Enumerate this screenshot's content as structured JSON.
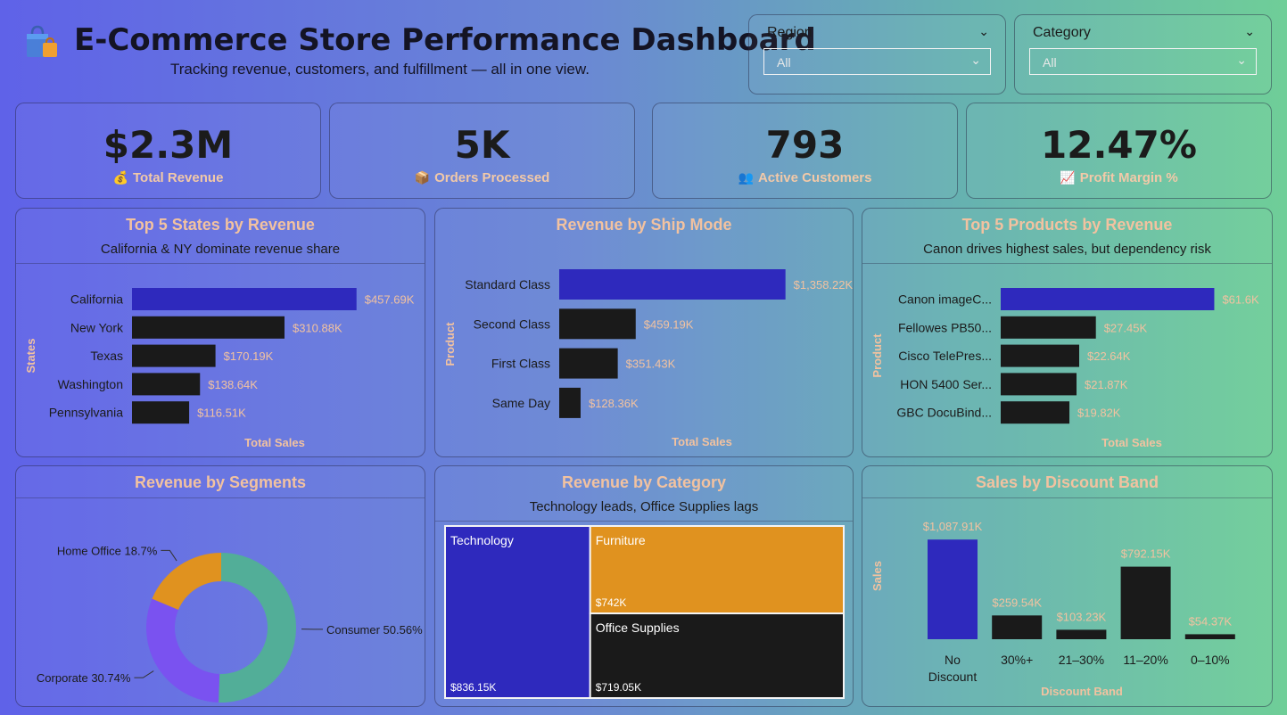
{
  "header": {
    "title": "E-Commerce Store Performance Dashboard",
    "subtitle": "Tracking revenue, customers, and fulfillment — all in one view.",
    "logo_icon": "shopping-bag-icon"
  },
  "slicers": [
    {
      "label": "Region",
      "value": "All"
    },
    {
      "label": "Category",
      "value": "All"
    }
  ],
  "kpis": [
    {
      "value": "$2.3M",
      "label": "Total Revenue",
      "icon": "💰"
    },
    {
      "value": "5K",
      "label": "Orders Processed",
      "icon": "📦"
    },
    {
      "value": "793",
      "label": "Active Customers",
      "icon": "👥"
    },
    {
      "value": "12.47%",
      "label": "Profit Margin %",
      "icon": "📈"
    }
  ],
  "colors": {
    "highlight": "#2e29bd",
    "bar": "#1a1a1a",
    "label": "#f2c2a0",
    "orange": "#e0921f",
    "teal": "#52ae98",
    "purple": "#7a52f0"
  },
  "panels": {
    "states": {
      "title": "Top 5 States by Revenue",
      "subtitle": "California & NY dominate revenue share"
    },
    "shipmode": {
      "title": "Revenue by Ship Mode"
    },
    "products": {
      "title": "Top 5 Products by Revenue",
      "subtitle": "Canon drives highest sales, but dependency risk"
    },
    "segments": {
      "title": "Revenue by Segments"
    },
    "category": {
      "title": "Revenue by Category",
      "subtitle": "Technology leads, Office Supplies lags"
    },
    "discount": {
      "title": "Sales by Discount Band"
    }
  },
  "chart_data": [
    {
      "id": "states",
      "type": "bar",
      "orientation": "horizontal",
      "categories": [
        "California",
        "New York",
        "Texas",
        "Washington",
        "Pennsylvania"
      ],
      "values": [
        457.69,
        310.88,
        170.19,
        138.64,
        116.51
      ],
      "labels": [
        "$457.69K",
        "$310.88K",
        "$170.19K",
        "$138.64K",
        "$116.51K"
      ],
      "xlabel": "Total Sales",
      "ylabel": "States",
      "xlim": [
        0,
        460
      ]
    },
    {
      "id": "shipmode",
      "type": "bar",
      "orientation": "horizontal",
      "categories": [
        "Standard Class",
        "Second Class",
        "First Class",
        "Same Day"
      ],
      "values": [
        1358.22,
        459.19,
        351.43,
        128.36
      ],
      "labels": [
        "$1,358.22K",
        "$459.19K",
        "$351.43K",
        "$128.36K"
      ],
      "xlabel": "Total Sales",
      "ylabel": "Product",
      "xlim": [
        0,
        1360
      ]
    },
    {
      "id": "products",
      "type": "bar",
      "orientation": "horizontal",
      "categories": [
        "Canon imageC...",
        "Fellowes PB50...",
        "Cisco TelePres...",
        "HON 5400 Ser...",
        "GBC DocuBind..."
      ],
      "values": [
        61.6,
        27.45,
        22.64,
        21.87,
        19.82
      ],
      "labels": [
        "$61.6K",
        "$27.45K",
        "$22.64K",
        "$21.87K",
        "$19.82K"
      ],
      "xlabel": "Total Sales",
      "ylabel": "Product",
      "xlim": [
        0,
        62
      ]
    },
    {
      "id": "segments",
      "type": "pie",
      "donut": true,
      "categories": [
        "Consumer",
        "Corporate",
        "Home Office"
      ],
      "values": [
        50.56,
        30.74,
        18.7
      ],
      "labels": [
        "Consumer 50.56%",
        "Corporate 30.74%",
        "Home Office 18.7%"
      ]
    },
    {
      "id": "category",
      "type": "treemap",
      "categories": [
        "Technology",
        "Furniture",
        "Office Supplies"
      ],
      "values": [
        836.15,
        742,
        719.05
      ],
      "labels": [
        "$836.15K",
        "$742K",
        "$719.05K"
      ]
    },
    {
      "id": "discount",
      "type": "bar",
      "orientation": "vertical",
      "categories": [
        "No Discount",
        "30%+",
        "21–30%",
        "11–20%",
        "0–10%"
      ],
      "category_lines": [
        [
          "No",
          "Discount"
        ],
        [
          "30%+"
        ],
        [
          "21–30%"
        ],
        [
          "11–20%"
        ],
        [
          "0–10%"
        ]
      ],
      "values": [
        1087.91,
        259.54,
        103.23,
        792.15,
        54.37
      ],
      "labels": [
        "$1,087.91K",
        "$259.54K",
        "$103.23K",
        "$792.15K",
        "$54.37K"
      ],
      "xlabel": "Discount Band",
      "ylabel": "Sales",
      "ylim": [
        0,
        1090
      ]
    }
  ]
}
